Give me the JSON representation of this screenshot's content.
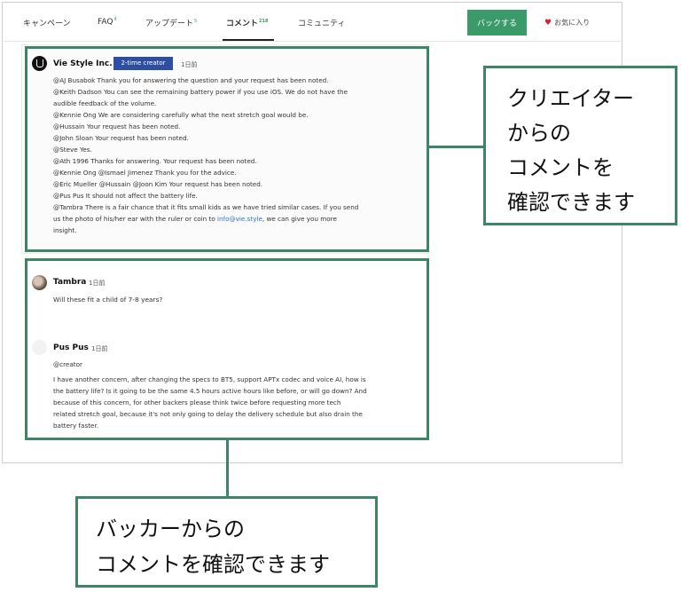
{
  "tabs": [
    {
      "label": "キャンペーン",
      "count": ""
    },
    {
      "label": "FAQ",
      "count": "4"
    },
    {
      "label": "アップデート",
      "count": "5"
    },
    {
      "label": "コメント",
      "count": "218"
    },
    {
      "label": "コミュニティ",
      "count": ""
    }
  ],
  "header": {
    "back_label": "バックする",
    "favorite_label": "お気に入り"
  },
  "creator_comment": {
    "name": "Vie Style Inc.",
    "badge": "2-time creator",
    "time": "1日前",
    "lines": [
      "@AJ Busabok Thank you for answering the question and your request has been noted.",
      "@Keith Dadson You can see the remaining battery power if you use iOS. We do not have the",
      "audible feedback of the volume.",
      "@Kennie Ong We are considering carefully what the next stretch goal would be.",
      "@Hussain Your request has been noted.",
      "@John Sloan Your request has been noted.",
      "@Steve Yes.",
      "@Ath 1996 Thanks for answering. Your request has been noted.",
      "@Kennie Ong @Ismael Jimenez Thank you for the advice.",
      "@Eric Mueller @Hussain @Joon Kim Your request has been noted.",
      "@Pus Pus It should not affect the battery life.",
      "@Tambra There is a fair chance that it fits small kids as we have tried similar cases. If you send"
    ],
    "line_link_pre": "us the photo of his/her ear with the ruler or coin to ",
    "link": "info@vie.style",
    "line_link_post": ", we can give you more",
    "last_line": "insight."
  },
  "backer_comments": {
    "tambra": {
      "name": "Tambra",
      "time": "1日前",
      "text": "Will these fit a child of 7-8 years?"
    },
    "pus": {
      "name": "Pus Pus",
      "time": "1日前",
      "mention": "@creator",
      "lines": [
        "I have another concern, after changing the specs to BT5, support APTx codec and voice AI, how is",
        "the battery life? Is it going to be the same 4.5 hours active hours like before, or will go down? And",
        "because of this concern, for other backers please think twice before requesting more tech",
        "related stretch goal, because it's not only going to delay the delivery schedule but also drain the",
        "battery faster."
      ]
    }
  },
  "callouts": {
    "creator": [
      "クリエイター",
      "からの",
      "コメントを",
      "確認できます"
    ],
    "backer": [
      "バッカーからの",
      "コメントを確認できます"
    ]
  },
  "colors": {
    "accent_green": "#3c8566",
    "button_green": "#3a9a6a",
    "badge_blue": "#2e4fa0",
    "heart_red": "#d2233c",
    "link_blue": "#2e6fd0"
  },
  "icons": {
    "favorite": "heart-icon"
  }
}
